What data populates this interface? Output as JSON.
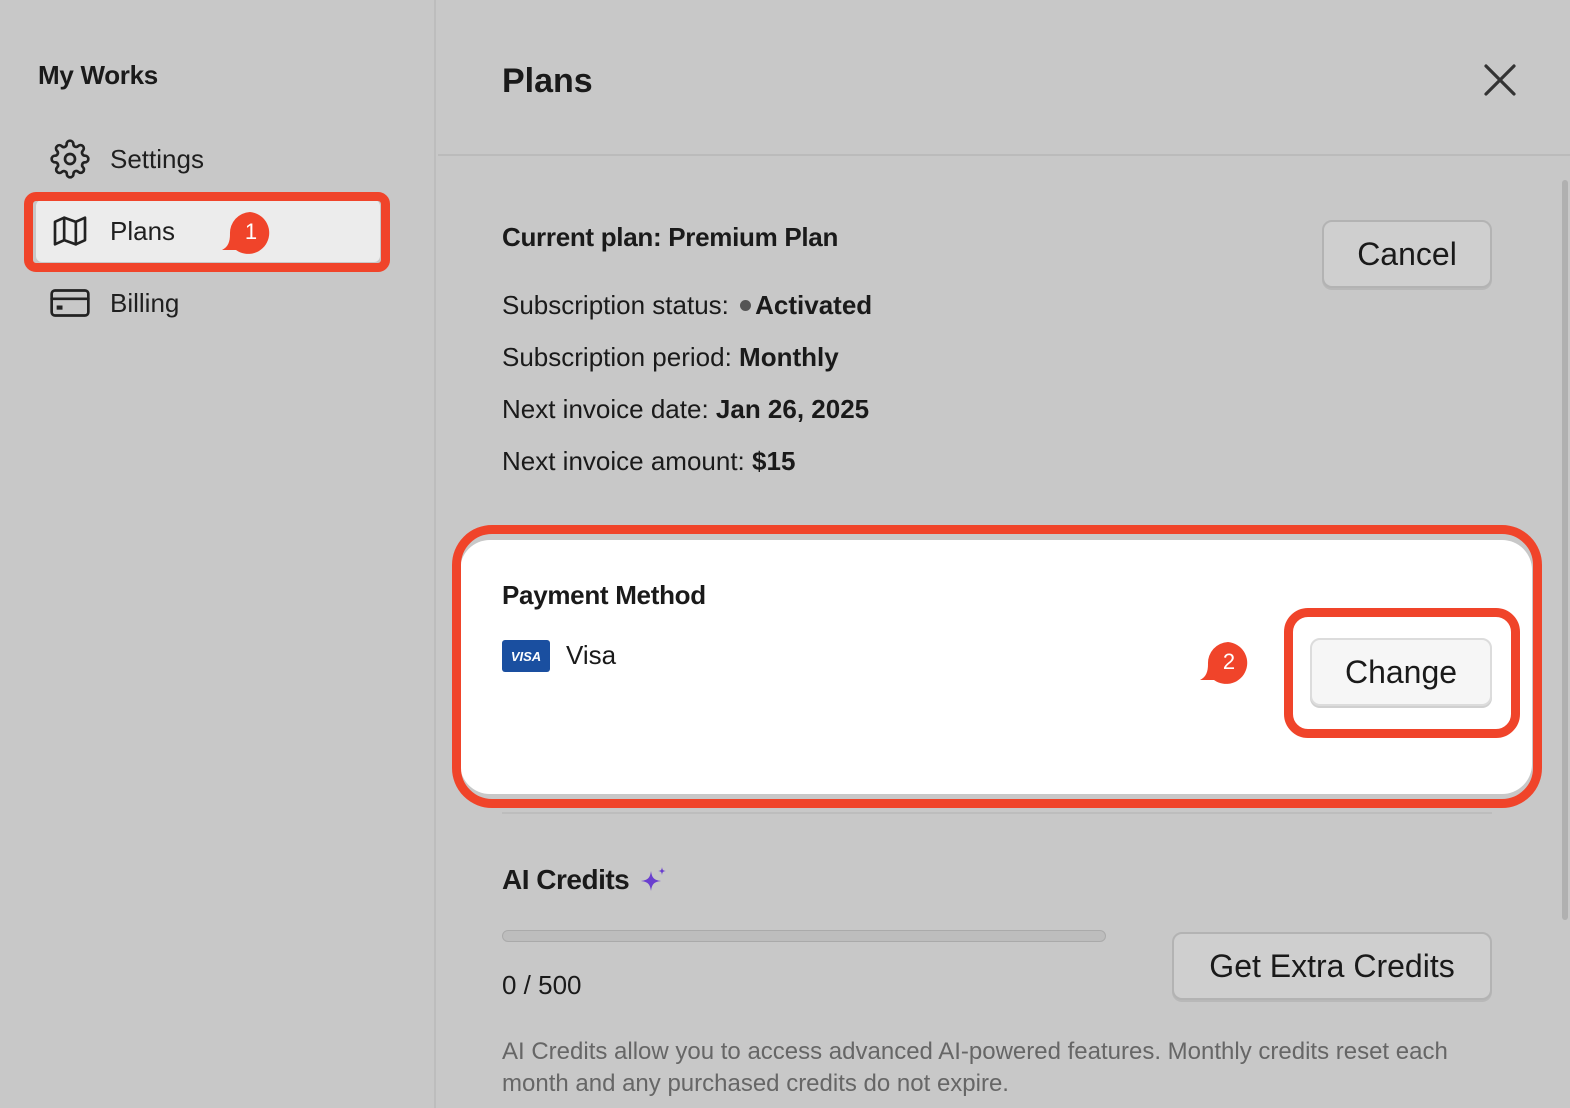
{
  "sidebar": {
    "title": "My Works",
    "items": [
      {
        "label": "Settings",
        "icon": "gear-icon"
      },
      {
        "label": "Plans",
        "icon": "map-icon"
      },
      {
        "label": "Billing",
        "icon": "credit-card-icon"
      }
    ]
  },
  "annotations": {
    "marker_1": "1",
    "marker_2": "2",
    "highlight_color": "#f0442a"
  },
  "main": {
    "title": "Plans",
    "close_icon": "close-icon",
    "current_plan": {
      "heading": "Current plan: Premium Plan",
      "cancel_label": "Cancel",
      "status_label": "Subscription status:",
      "status_value": "Activated",
      "period_label": "Subscription period:",
      "period_value": "Monthly",
      "next_date_label": "Next invoice date:",
      "next_date_value": "Jan 26, 2025",
      "next_amount_label": "Next invoice amount:",
      "next_amount_value": "$15"
    },
    "payment": {
      "heading": "Payment Method",
      "card_logo": "VISA",
      "card_name": "Visa",
      "change_label": "Change"
    },
    "credits": {
      "heading": "AI Credits",
      "sparkle_icon": "sparkle-icon",
      "used": 0,
      "total": 500,
      "count_text": "0 / 500",
      "progress_fraction": 0,
      "button_label": "Get Extra Credits",
      "description": "AI Credits allow you to access advanced AI-powered features. Monthly credits reset each month and any purchased credits do not expire."
    }
  },
  "colors": {
    "background": "#c8c8c8",
    "active_nav": "#ececec",
    "visa_blue": "#1a4fa0",
    "sparkle_purple": "#6a3fcf"
  }
}
